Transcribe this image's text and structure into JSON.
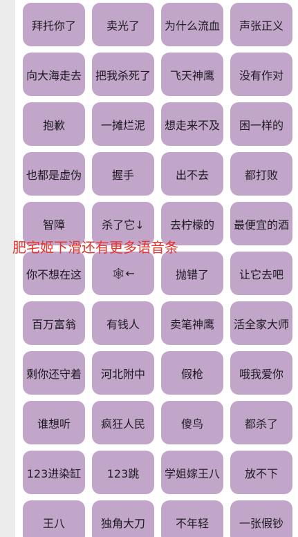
{
  "buttons": [
    "拜托你了",
    "卖光了",
    "为什么流血",
    "声张正义",
    "向大海走去",
    "把我杀死了",
    "飞天神鹰",
    "没有作对",
    "抱歉",
    "一摊烂泥",
    "想走来不及",
    "困一样的",
    "也都是虚伪",
    "握手",
    "出不去",
    "都打败",
    "智障",
    "杀了它↓",
    "去柠檬的",
    "最便宜的酒",
    "你不想在这",
    "🕸←",
    "抛错了",
    "让它去吧",
    "百万富翁",
    "有钱人",
    "卖笔神鹰",
    "活全家大师",
    "剩你还守着",
    "河北附中",
    "假枪",
    "哦我爱你",
    "谁想听",
    "疯狂人民",
    "傻鸟",
    "都杀了",
    "123进染缸",
    "123跳",
    "学姐嫁王八",
    "放不下",
    "王八",
    "独角大刀",
    "不年轻",
    "一张假钞"
  ],
  "hint": "肥宅姬下滑还有更多语音条",
  "colors": {
    "button_bg": "#c2a6c9",
    "hint_text": "#e8322c"
  }
}
